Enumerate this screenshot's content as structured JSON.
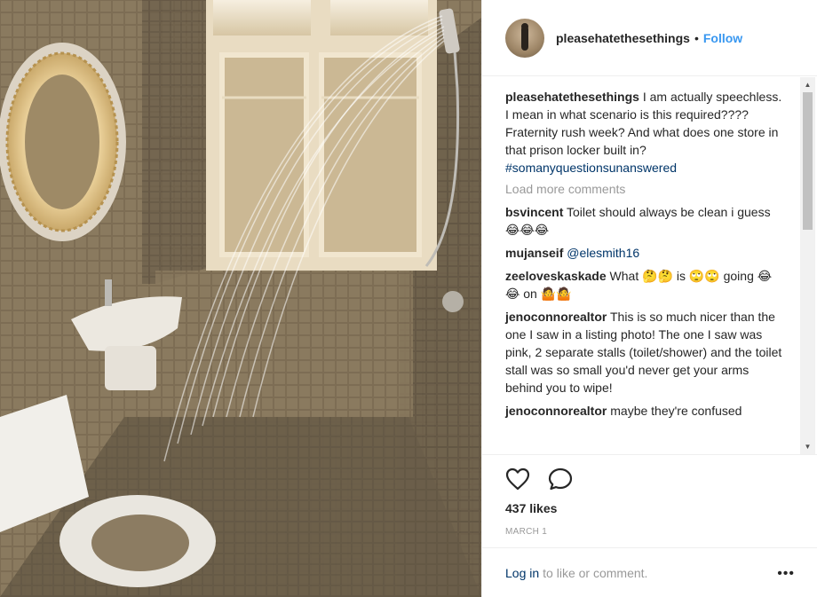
{
  "post": {
    "username": "pleasehatethesethings",
    "separator": "•",
    "follow_label": "Follow"
  },
  "caption": {
    "username": "pleasehatethesethings",
    "text": "I am actually speechless. I mean in what scenario is this required???? Fraternity rush week? And what does one store in that prison locker built in?",
    "hashtag": "#somanyquestionsunanswered"
  },
  "load_more_label": "Load more comments",
  "comments": [
    {
      "username": "bsvincent",
      "text": "Toilet should always be clean i guess 😂😂😂"
    },
    {
      "username": "mujanseif",
      "mention": "@elesmith16"
    },
    {
      "username": "zeeloveskaskade",
      "text": "What 🤔🤔 is 🙄🙄 going 😂😂 on 🤷🤷"
    },
    {
      "username": "jenoconnorealtor",
      "text": "This is so much nicer than the one I saw in a listing photo! The one I saw was pink, 2 separate stalls (toilet/shower) and the toilet stall was so small you'd never get your arms behind you to wipe!"
    },
    {
      "username": "jenoconnorealtor",
      "text": "maybe they're confused"
    }
  ],
  "scrollbar": {
    "up": "▲",
    "down": "▼"
  },
  "icons": {
    "like": "heart-icon",
    "comment": "comment-icon"
  },
  "likes_label": "437 likes",
  "date_label": "MARCH 1",
  "login": {
    "link": "Log in",
    "rest": "to like or comment.",
    "more": "•••"
  }
}
